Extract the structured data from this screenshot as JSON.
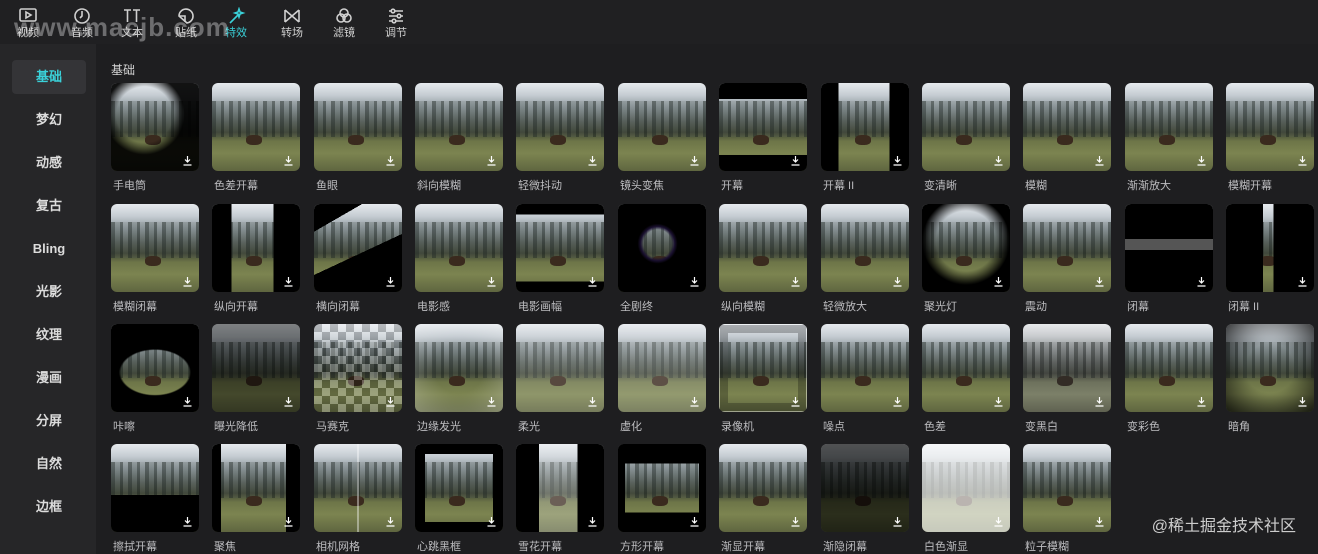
{
  "toolbar": {
    "tabs": [
      {
        "label": "视频",
        "icon": "video-icon"
      },
      {
        "label": "音频",
        "icon": "audio-icon"
      },
      {
        "label": "文本",
        "icon": "text-icon"
      },
      {
        "label": "贴纸",
        "icon": "sticker-icon"
      },
      {
        "label": "特效",
        "icon": "effects-icon",
        "active": true
      },
      {
        "label": "转场",
        "icon": "transition-icon"
      },
      {
        "label": "滤镜",
        "icon": "filter-icon"
      },
      {
        "label": "调节",
        "icon": "adjust-icon"
      }
    ],
    "watermark_text": "www.macjb.com"
  },
  "sidebar": {
    "items": [
      "基础",
      "梦幻",
      "动感",
      "复古",
      "Bling",
      "光影",
      "纹理",
      "漫画",
      "分屏",
      "自然",
      "边框"
    ],
    "active_index": 0
  },
  "main": {
    "section_title": "基础",
    "effects": [
      "手电筒",
      "色差开幕",
      "鱼眼",
      "斜向模糊",
      "轻微抖动",
      "镜头变焦",
      "开幕",
      "开幕 II",
      "变清晰",
      "模糊",
      "渐渐放大",
      "模糊开幕",
      "模糊闭幕",
      "纵向开幕",
      "横向闭幕",
      "电影感",
      "电影画幅",
      "全剧终",
      "纵向模糊",
      "轻微放大",
      "聚光灯",
      "震动",
      "闭幕",
      "闭幕 II",
      "咔嚓",
      "曝光降低",
      "马赛克",
      "边缘发光",
      "柔光",
      "虚化",
      "录像机",
      "噪点",
      "色差",
      "变黑白",
      "变彩色",
      "暗角",
      "擦拭开幕",
      "聚焦",
      "相机网格",
      "心跳黑框",
      "雪花开幕",
      "方形开幕",
      "渐显开幕",
      "渐隐闭幕",
      "白色渐显",
      "粒子模糊"
    ]
  },
  "footer": {
    "watermark": "@稀土掘金技术社区"
  },
  "colors": {
    "accent": "#3ad1d9",
    "background": "#1e1e20",
    "sidebar": "#262628",
    "toolbar": "#202022"
  }
}
